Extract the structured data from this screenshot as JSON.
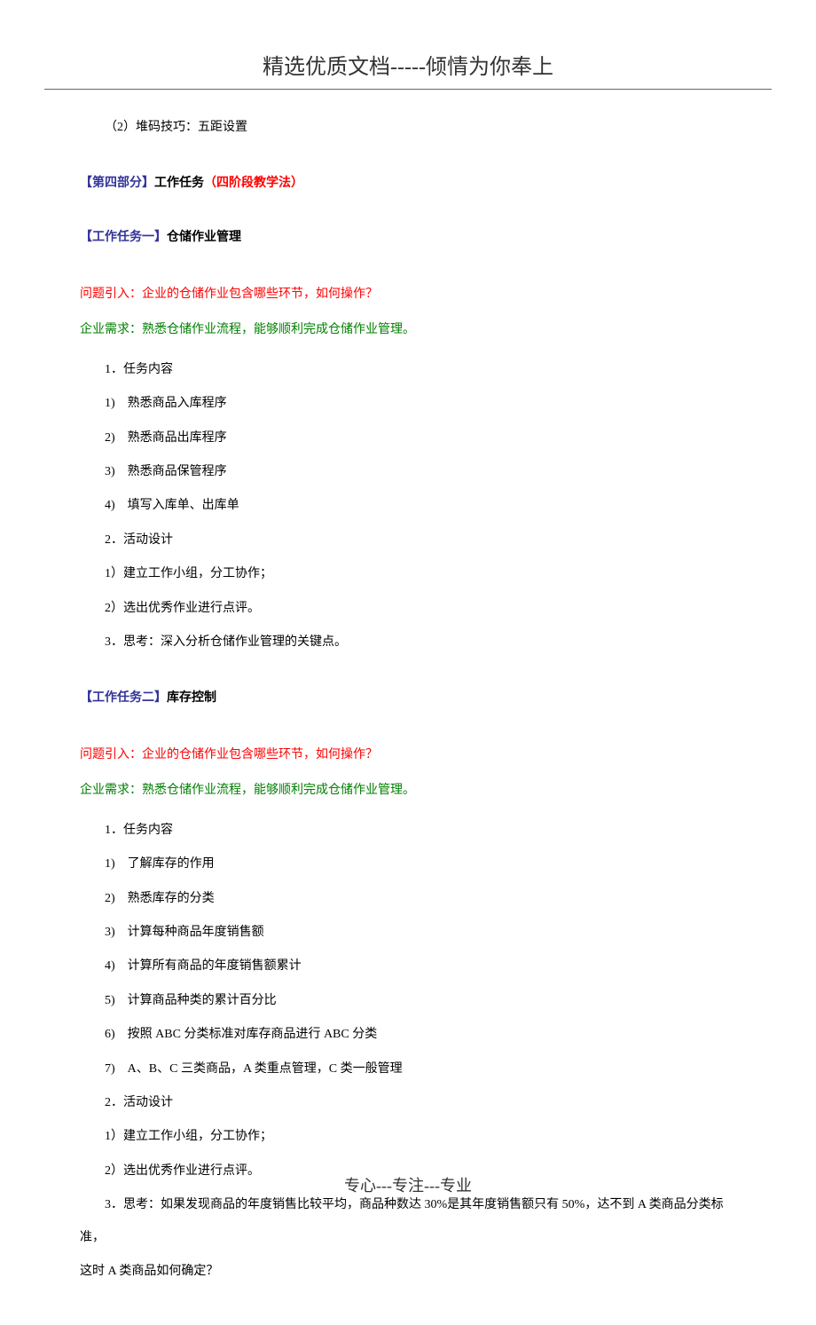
{
  "header": "精选优质文档-----倾情为你奉上",
  "footer": "专心---专注---专业",
  "intro_line": "（2）堆码技巧：五距设置",
  "section4": {
    "bracket": "【第四部分】",
    "title": "工作任务",
    "paren": "（四阶段教学法）"
  },
  "task1": {
    "bracket": "【工作任务一】",
    "title": "仓储作业管理",
    "question": "问题引入：企业的仓储作业包含哪些环节，如何操作？",
    "need": "企业需求：熟悉仓储作业流程，能够顺利完成仓储作业管理。",
    "items": [
      "1．任务内容",
      "1)　熟悉商品入库程序",
      "2)　熟悉商品出库程序",
      "3)　熟悉商品保管程序",
      "4)　填写入库单、出库单",
      "2．活动设计",
      "1）建立工作小组，分工协作；",
      "2）选出优秀作业进行点评。",
      "3．思考：深入分析仓储作业管理的关键点。"
    ]
  },
  "task2": {
    "bracket": "【工作任务二】",
    "title": "库存控制",
    "question": "问题引入：企业的仓储作业包含哪些环节，如何操作？",
    "need": "企业需求：熟悉仓储作业流程，能够顺利完成仓储作业管理。",
    "items": [
      "1．任务内容",
      "1)　了解库存的作用",
      "2)　熟悉库存的分类",
      "3)　计算每种商品年度销售额",
      "4)　计算所有商品的年度销售额累计",
      "5)　计算商品种类的累计百分比",
      "6)　按照 ABC 分类标准对库存商品进行 ABC 分类",
      "7)　A、B、C 三类商品，A 类重点管理，C 类一般管理",
      "2．活动设计",
      "1）建立工作小组，分工协作；",
      "2）选出优秀作业进行点评。"
    ],
    "thinking_indent": "3．思考：如果发现商品的年度销售比较平均，商品种数达 30%是其年度销售额只有 50%，达不到 A 类商品分类标准，",
    "thinking_noindent": "这时 A 类商品如何确定？"
  }
}
